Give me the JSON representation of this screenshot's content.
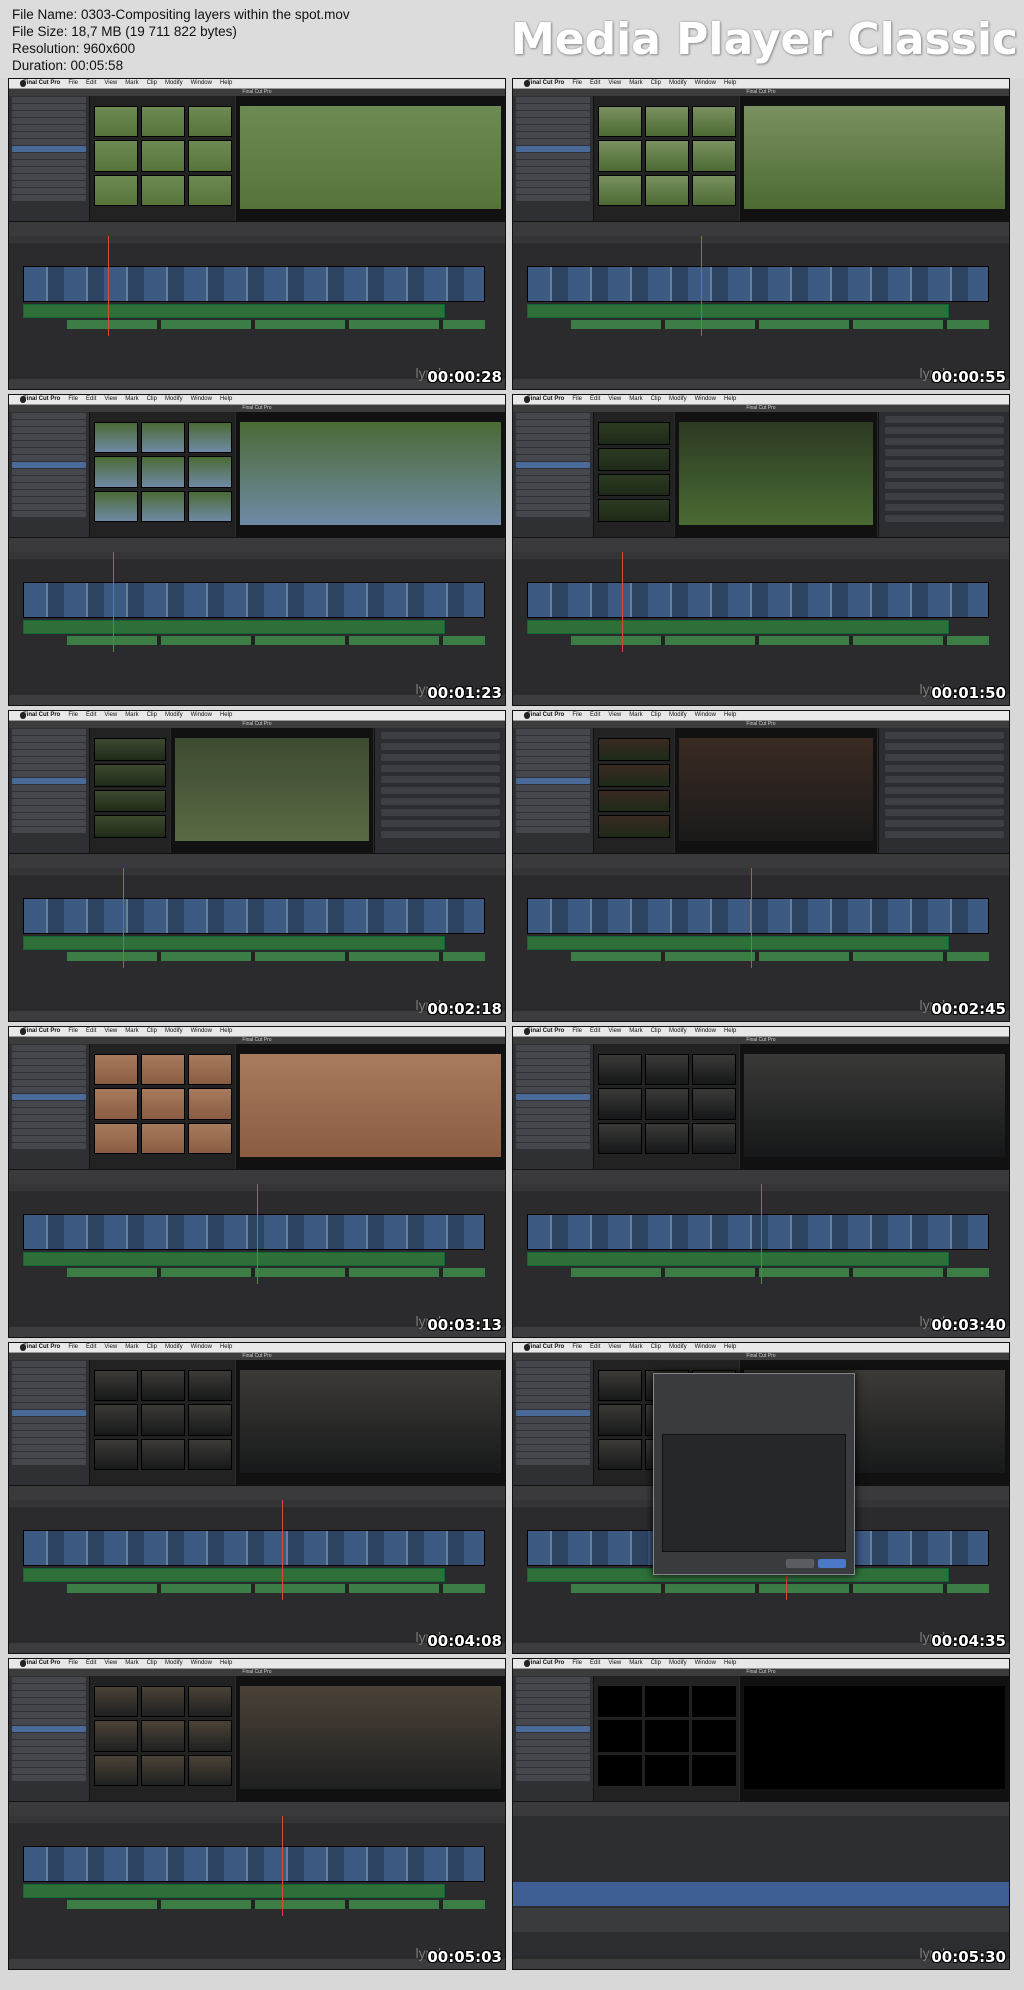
{
  "file_info": {
    "name": "File Name: 0303-Compositing layers within the spot.mov",
    "size": "File Size: 18,7 MB (19 711 822 bytes)",
    "resolution": "Resolution: 960x600",
    "duration": "Duration: 00:05:58"
  },
  "brand": "Media Player Classic",
  "app": {
    "menu": [
      "Final Cut Pro",
      "File",
      "Edit",
      "View",
      "Mark",
      "Clip",
      "Modify",
      "Window",
      "Help"
    ],
    "window_title": "Final Cut Pro",
    "watermark": "lynda"
  },
  "frames": [
    {
      "timestamp": "00:00:28",
      "variant": "browser",
      "video": "#56743a",
      "video2": "#6e8a54",
      "playhead": 0.2
    },
    {
      "timestamp": "00:00:55",
      "variant": "browser",
      "video": "#4d6a33",
      "video2": "#7a9060",
      "playhead": 0.38
    },
    {
      "timestamp": "00:01:23",
      "variant": "browser",
      "video": "#6f8aa6",
      "video2": "#4a6a34",
      "playhead": 0.21
    },
    {
      "timestamp": "00:01:50",
      "variant": "inspector",
      "video": "#4a6a33",
      "video2": "#2c3a22",
      "playhead": 0.22
    },
    {
      "timestamp": "00:02:18",
      "variant": "inspector",
      "video": "#5a6a44",
      "video2": "#3d4a30",
      "playhead": 0.23
    },
    {
      "timestamp": "00:02:45",
      "variant": "inspector",
      "video": "#1a1a1a",
      "video2": "#3a2a22",
      "playhead": 0.48
    },
    {
      "timestamp": "00:03:13",
      "variant": "browser",
      "video": "#8a5d43",
      "video2": "#a87b5e",
      "playhead": 0.5
    },
    {
      "timestamp": "00:03:40",
      "variant": "browser",
      "video": "#151718",
      "video2": "#3a3a38",
      "playhead": 0.5
    },
    {
      "timestamp": "00:04:08",
      "variant": "browser",
      "video": "#17191a",
      "video2": "#3c3a36",
      "playhead": 0.55
    },
    {
      "timestamp": "00:04:35",
      "variant": "dialog",
      "video": "#17191a",
      "video2": "#3c3a36",
      "playhead": 0.55
    },
    {
      "timestamp": "00:05:03",
      "variant": "browser",
      "video": "#1e2020",
      "video2": "#4b4236",
      "playhead": 0.55
    },
    {
      "timestamp": "00:05:30",
      "variant": "project",
      "video": "#000000",
      "video2": "#000000",
      "playhead": 0.5
    }
  ]
}
